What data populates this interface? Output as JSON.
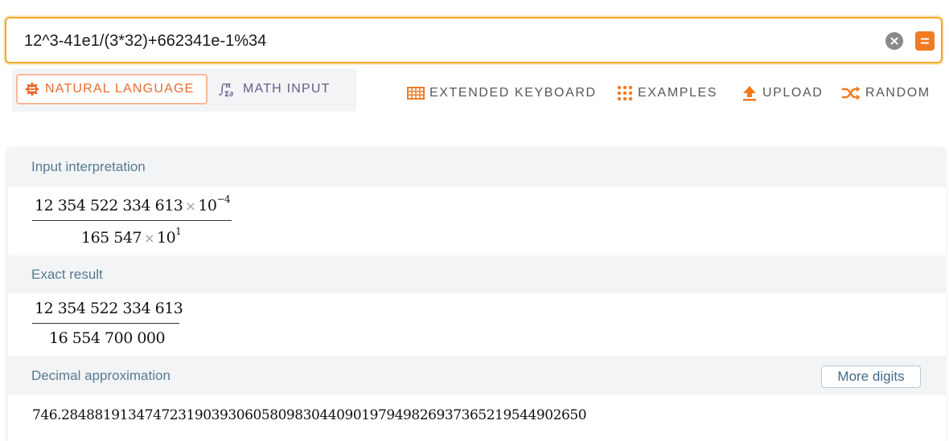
{
  "search": {
    "query": "12^3-41e1/(3*32)+662341e-1%34"
  },
  "modes": {
    "natural_language": "NATURAL LANGUAGE",
    "math_input": "MATH INPUT"
  },
  "toolbar": {
    "extended_keyboard": "EXTENDED KEYBOARD",
    "examples": "EXAMPLES",
    "upload": "UPLOAD",
    "random": "RANDOM"
  },
  "pods": {
    "input_interpretation": {
      "title": "Input interpretation",
      "numerator_mantissa": "12 354 522 334 613",
      "numerator_times": "×",
      "numerator_base": "10",
      "numerator_exp": "−4",
      "denominator_mantissa": "165 547",
      "denominator_times": "×",
      "denominator_base": "10",
      "denominator_exp": "1"
    },
    "exact_result": {
      "title": "Exact result",
      "numerator": "12 354 522 334 613",
      "denominator": "16 554 700 000"
    },
    "decimal_approximation": {
      "title": "Decimal approximation",
      "more_digits_label": "More digits",
      "value": "746.284881913474723190393060580983044090197949826937365219544902650"
    }
  },
  "colors": {
    "accent": "#f47a20",
    "focus_border": "#f5a623",
    "pod_title": "#577b92"
  },
  "icons": {
    "clear": "clear-icon",
    "equals": "equals-icon",
    "natural_language": "natural-language-icon",
    "math_input": "math-input-icon",
    "keyboard": "keyboard-grid-icon",
    "examples": "dots-grid-icon",
    "upload": "upload-icon",
    "random": "shuffle-icon"
  }
}
